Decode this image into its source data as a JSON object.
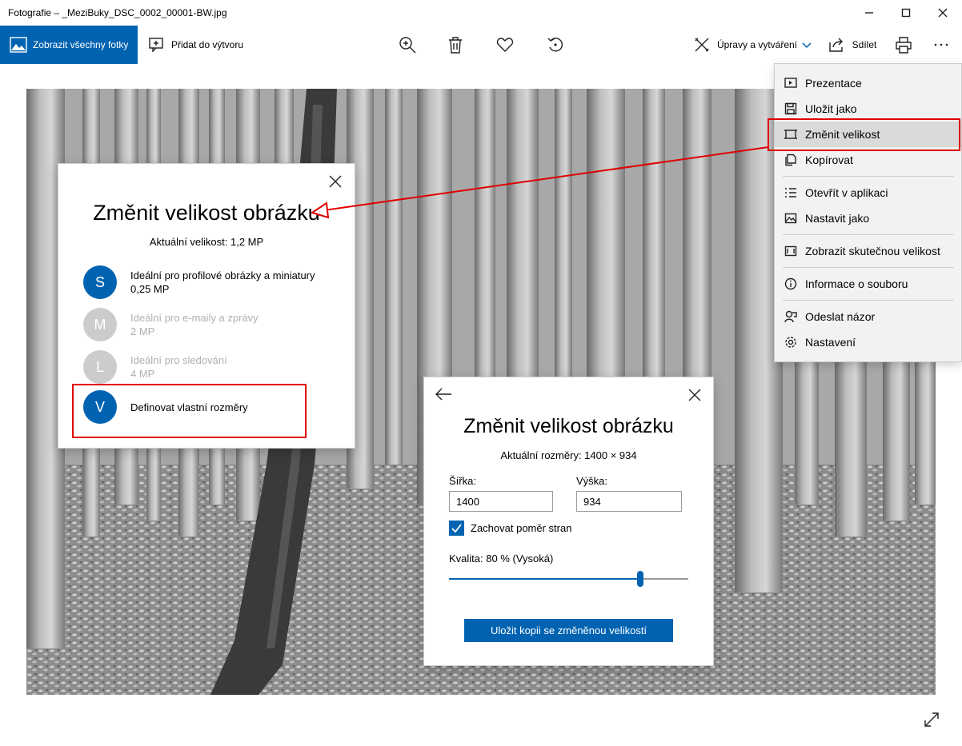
{
  "window": {
    "title": "Fotografie – _MeziBuky_DSC_0002_00001-BW.jpg"
  },
  "toolbar": {
    "all_photos": "Zobrazit všechny fotky",
    "add_to_creation": "Přidat do výtvoru",
    "edit_create": "Úpravy a vytváření",
    "share": "Sdílet"
  },
  "menu": {
    "items": [
      {
        "label": "Prezentace",
        "icon": "slideshow-icon"
      },
      {
        "label": "Uložit jako",
        "icon": "save-icon"
      },
      {
        "label": "Změnit velikost",
        "icon": "resize-icon"
      },
      {
        "label": "Kopírovat",
        "icon": "copy-icon"
      },
      {
        "label": "Otevřít v aplikaci",
        "icon": "open-with-icon"
      },
      {
        "label": "Nastavit jako",
        "icon": "set-as-icon"
      },
      {
        "label": "Zobrazit skutečnou velikost",
        "icon": "actual-size-icon"
      },
      {
        "label": "Informace o souboru",
        "icon": "info-icon"
      },
      {
        "label": "Odeslat názor",
        "icon": "feedback-icon"
      },
      {
        "label": "Nastavení",
        "icon": "settings-icon"
      }
    ]
  },
  "dialog1": {
    "title": "Změnit velikost obrázku",
    "current": "Aktuální velikost: 1,2 MP",
    "options": [
      {
        "letter": "S",
        "label": "Ideální pro profilové obrázky a miniatury",
        "size": "0,25 MP",
        "enabled": true
      },
      {
        "letter": "M",
        "label": "Ideální pro e-maily a zprávy",
        "size": "2 MP",
        "enabled": false
      },
      {
        "letter": "L",
        "label": "Ideální pro sledování",
        "size": "4 MP",
        "enabled": false
      },
      {
        "letter": "V",
        "label": "Definovat vlastní rozměry",
        "size": "",
        "enabled": true
      }
    ]
  },
  "dialog2": {
    "title": "Změnit velikost obrázku",
    "current": "Aktuální rozměry: 1400 × 934",
    "width_label": "Šířka:",
    "width_value": "1400",
    "height_label": "Výška:",
    "height_value": "934",
    "keep_ratio_label": "Zachovat poměr stran",
    "keep_ratio_checked": true,
    "quality_label": "Kvalita: 80 % (Vysoká)",
    "quality_percent": 80,
    "save_button": "Uložit kopii se změněnou velikostí"
  },
  "colors": {
    "accent": "#0063b1",
    "highlight": "#e00000",
    "menu_bg": "#f2f2f2"
  }
}
